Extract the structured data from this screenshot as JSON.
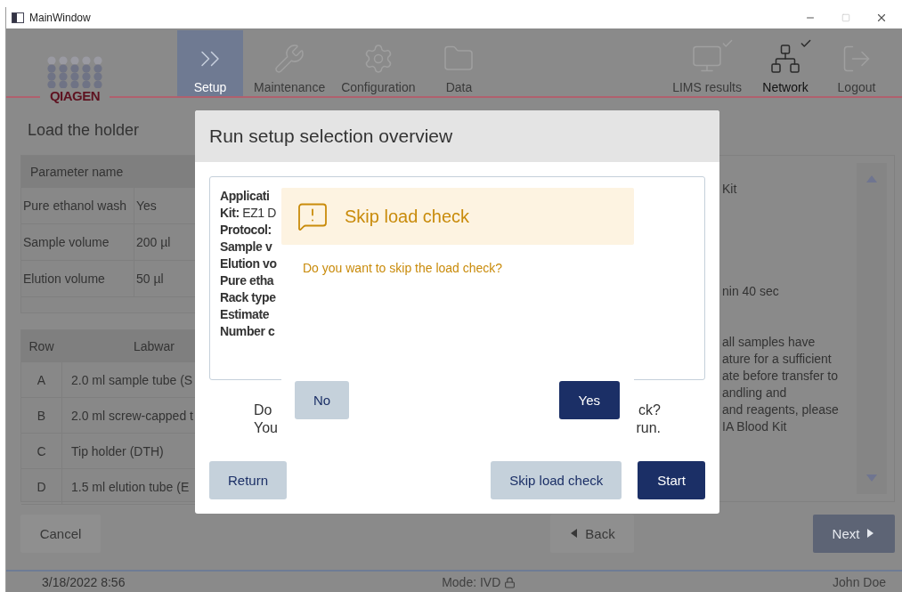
{
  "window": {
    "title": "MainWindow"
  },
  "nav": {
    "logo": "QIAGEN",
    "items": [
      {
        "label": "Setup",
        "selected": true,
        "disabled": false,
        "checked": false
      },
      {
        "label": "Maintenance",
        "selected": false,
        "disabled": true,
        "checked": false
      },
      {
        "label": "Configuration",
        "selected": false,
        "disabled": true,
        "checked": false
      },
      {
        "label": "Data",
        "selected": false,
        "disabled": true,
        "checked": false
      },
      {
        "label": "LIMS results",
        "selected": false,
        "disabled": true,
        "checked": true
      },
      {
        "label": "Network",
        "selected": false,
        "disabled": false,
        "checked": true
      },
      {
        "label": "Logout",
        "selected": false,
        "disabled": true,
        "checked": false
      }
    ]
  },
  "page": {
    "title": "Load the holder",
    "parameters": {
      "columns": [
        "Parameter name"
      ],
      "rows": [
        [
          "Pure ethanol wash",
          "Yes"
        ],
        [
          "Sample volume",
          "200 µl"
        ],
        [
          "Elution volume",
          "50 µl"
        ]
      ]
    },
    "labware": {
      "columns": [
        "Row",
        "Labwar"
      ],
      "rows": [
        [
          "A",
          "2.0 ml sample tube (S"
        ],
        [
          "B",
          "2.0 ml screw-capped t"
        ],
        [
          "C",
          "Tip holder (DTH)"
        ],
        [
          "D",
          "1.5 ml elution tube (E"
        ]
      ]
    },
    "details": [
      [
        "Kit"
      ],
      [
        "nin 40 sec"
      ],
      [
        "all samples have",
        "ature for a sufficient",
        "ate before transfer to",
        "andling and",
        "and reagents, please",
        "IA Blood Kit"
      ]
    ]
  },
  "footer": [
    {
      "label": "Cancel",
      "kind": "plain"
    },
    {
      "label": "Back",
      "kind": "back"
    },
    {
      "label": "Next",
      "kind": "next"
    }
  ],
  "status_bar": {
    "date": "3/18/2022 8:56",
    "mode": "Mode: IVD",
    "user": "John Doe"
  },
  "dialog": {
    "title": "Run setup selection overview",
    "summary": [
      {
        "label": "Applicati"
      },
      {
        "label": "Kit:",
        "value": "EZ1 D"
      },
      {
        "label": "Protocol:"
      },
      {
        "label": "Sample v"
      },
      {
        "label": "Elution vo"
      },
      {
        "label": "Pure etha"
      },
      {
        "label": "Rack type"
      },
      {
        "label": "Estimate"
      },
      {
        "label": "Number c"
      }
    ],
    "question": [
      [
        "Do",
        "ck?"
      ],
      [
        "You",
        "run."
      ]
    ],
    "buttons": [
      {
        "label": "Return",
        "kind": "secondary"
      },
      {
        "label": "Skip load check",
        "kind": "secondary"
      },
      {
        "label": "Start",
        "kind": "primary"
      }
    ]
  },
  "alert": {
    "title": "Skip load check",
    "message": "Do you want to skip the load check?",
    "buttons": [
      {
        "label": "No",
        "kind": "secondary"
      },
      {
        "label": "Yes",
        "kind": "primary"
      }
    ]
  }
}
